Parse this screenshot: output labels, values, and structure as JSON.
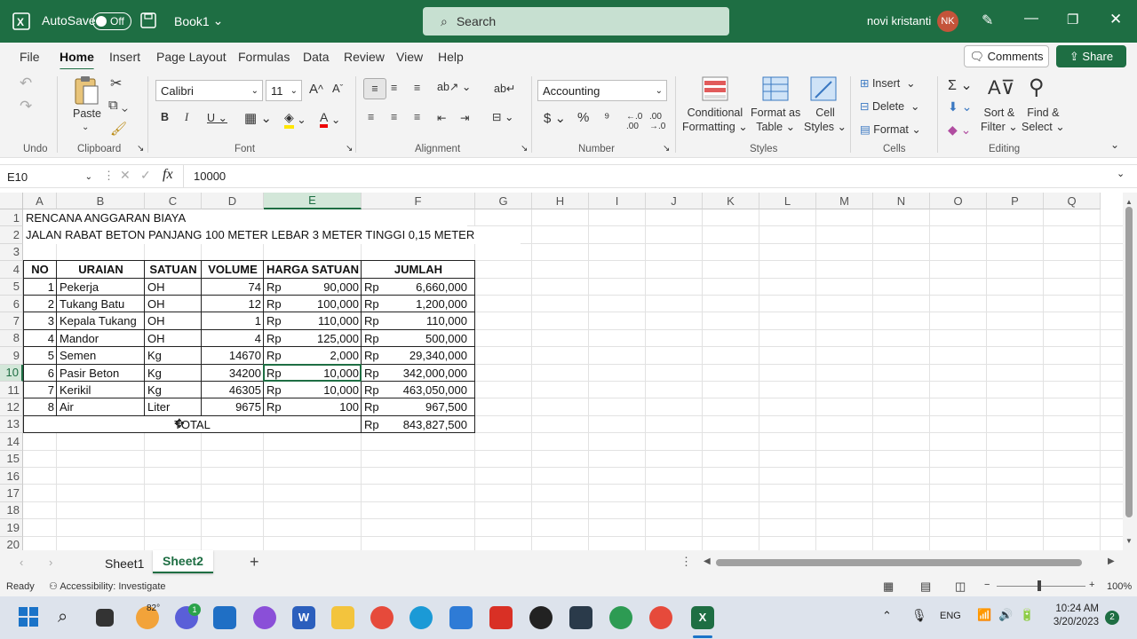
{
  "titlebar": {
    "autosave_label": "AutoSave",
    "autosave_state": "Off",
    "workbook": "Book1",
    "search_placeholder": "Search",
    "user": "novi kristanti",
    "user_initials": "NK"
  },
  "menu": [
    "File",
    "Home",
    "Insert",
    "Page Layout",
    "Formulas",
    "Data",
    "Review",
    "View",
    "Help"
  ],
  "menu_active": "Home",
  "comments_label": "Comments",
  "share_label": "Share",
  "ribbon": {
    "undo_group": "Undo",
    "clipboard_group": "Clipboard",
    "paste_label": "Paste",
    "font_group": "Font",
    "font_name": "Calibri",
    "font_size": "11",
    "alignment_group": "Alignment",
    "number_group": "Number",
    "number_format": "Accounting",
    "styles_group": "Styles",
    "conditional_formatting": [
      "Conditional",
      "Formatting"
    ],
    "format_as_table": [
      "Format as",
      "Table"
    ],
    "cell_styles": [
      "Cell",
      "Styles"
    ],
    "cells_group": "Cells",
    "insert_label": "Insert",
    "delete_label": "Delete",
    "format_label": "Format",
    "editing_group": "Editing",
    "sort_filter": [
      "Sort &",
      "Filter"
    ],
    "find_select": [
      "Find &",
      "Select"
    ]
  },
  "formula_bar": {
    "name_box": "E10",
    "fx": "fx",
    "value": "10000"
  },
  "columns": [
    "A",
    "B",
    "C",
    "D",
    "E",
    "F",
    "G",
    "H",
    "I",
    "J",
    "K",
    "L",
    "M",
    "N",
    "O",
    "P",
    "Q"
  ],
  "selected_column": "E",
  "rows": [
    "1",
    "2",
    "3",
    "4",
    "5",
    "6",
    "7",
    "8",
    "9",
    "10",
    "11",
    "12",
    "13",
    "14",
    "15",
    "16",
    "17",
    "18",
    "19",
    "20"
  ],
  "selected_row": "10",
  "sheet": {
    "title1": "RENCANA ANGGARAN BIAYA",
    "title2": "JALAN RABAT BETON PANJANG 100 METER LEBAR 3 METER TINGGI 0,15 METER",
    "headers": [
      "NO",
      "URAIAN",
      "SATUAN",
      "VOLUME",
      "HARGA SATUAN",
      "JUMLAH"
    ],
    "currency": "Rp",
    "items": [
      {
        "no": "1",
        "uraian": "Pekerja",
        "satuan": "OH",
        "volume": "74",
        "harga": "90,000",
        "jumlah": "6,660,000"
      },
      {
        "no": "2",
        "uraian": "Tukang Batu",
        "satuan": "OH",
        "volume": "12",
        "harga": "100,000",
        "jumlah": "1,200,000"
      },
      {
        "no": "3",
        "uraian": "Kepala Tukang",
        "satuan": "OH",
        "volume": "1",
        "harga": "110,000",
        "jumlah": "110,000"
      },
      {
        "no": "4",
        "uraian": "Mandor",
        "satuan": "OH",
        "volume": "4",
        "harga": "125,000",
        "jumlah": "500,000"
      },
      {
        "no": "5",
        "uraian": "Semen",
        "satuan": "Kg",
        "volume": "14670",
        "harga": "2,000",
        "jumlah": "29,340,000"
      },
      {
        "no": "6",
        "uraian": "Pasir Beton",
        "satuan": "Kg",
        "volume": "34200",
        "harga": "10,000",
        "jumlah": "342,000,000"
      },
      {
        "no": "7",
        "uraian": "Kerikil",
        "satuan": "Kg",
        "volume": "46305",
        "harga": "10,000",
        "jumlah": "463,050,000"
      },
      {
        "no": "8",
        "uraian": "Air",
        "satuan": "Liter",
        "volume": "9675",
        "harga": "100",
        "jumlah": "967,500"
      }
    ],
    "total_label": "TOTAL",
    "total_value": "843,827,500"
  },
  "sheets": [
    "Sheet1",
    "Sheet2"
  ],
  "active_sheet": "Sheet2",
  "status": {
    "ready": "Ready",
    "accessibility": "Accessibility: Investigate",
    "zoom": "100%"
  },
  "taskbar": {
    "weather": "82°",
    "chat_badge": "1",
    "lang": "ENG",
    "time": "10:24 AM",
    "date": "3/20/2023",
    "notif": "2"
  },
  "colors": {
    "excel_green": "#1e6e43",
    "selected_header": "#d3e7d9"
  }
}
